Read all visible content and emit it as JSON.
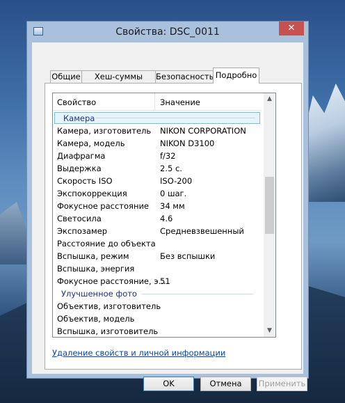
{
  "window": {
    "title": "Свойства: DSC_0011",
    "close_glyph": "✕"
  },
  "tabs": [
    {
      "label": "Общие"
    },
    {
      "label": "Хеш-суммы файлов"
    },
    {
      "label": "Безопасность"
    },
    {
      "label": "Подробно"
    }
  ],
  "list": {
    "headers": {
      "property": "Свойство",
      "value": "Значение"
    },
    "group1": "Камера",
    "rows": [
      {
        "p": "Камера, изготовитель",
        "v": "NIKON CORPORATION"
      },
      {
        "p": "Камера, модель",
        "v": "NIKON D3100"
      },
      {
        "p": "Диафрагма",
        "v": "f/32"
      },
      {
        "p": "Выдержка",
        "v": "2.5 с."
      },
      {
        "p": "Скорость ISO",
        "v": "ISO-200"
      },
      {
        "p": "Экспокоррекция",
        "v": "0 шаг."
      },
      {
        "p": "Фокусное расстояние",
        "v": "34 мм"
      },
      {
        "p": "Светосила",
        "v": "4.6"
      },
      {
        "p": "Экспозамер",
        "v": "Средневзвешенный"
      },
      {
        "p": "Расстояние до объекта",
        "v": ""
      },
      {
        "p": "Вспышка, режим",
        "v": "Без вспышки"
      },
      {
        "p": "Вспышка, энергия",
        "v": ""
      },
      {
        "p": "Фокусное расстояние, э...",
        "v": "51"
      }
    ],
    "group2": "Улучшенное фото",
    "rows2": [
      {
        "p": "Объектив, изготовитель",
        "v": ""
      },
      {
        "p": "Объектив, модель",
        "v": ""
      },
      {
        "p": "Вспышка, изготовитель",
        "v": ""
      }
    ]
  },
  "link": "Удаление свойств и личной информации",
  "buttons": {
    "ok": "OK",
    "cancel": "Отмена",
    "apply": "Применить"
  },
  "colors": {
    "accent": "#70c0e7",
    "link": "#0645ad",
    "close": "#c75050"
  }
}
